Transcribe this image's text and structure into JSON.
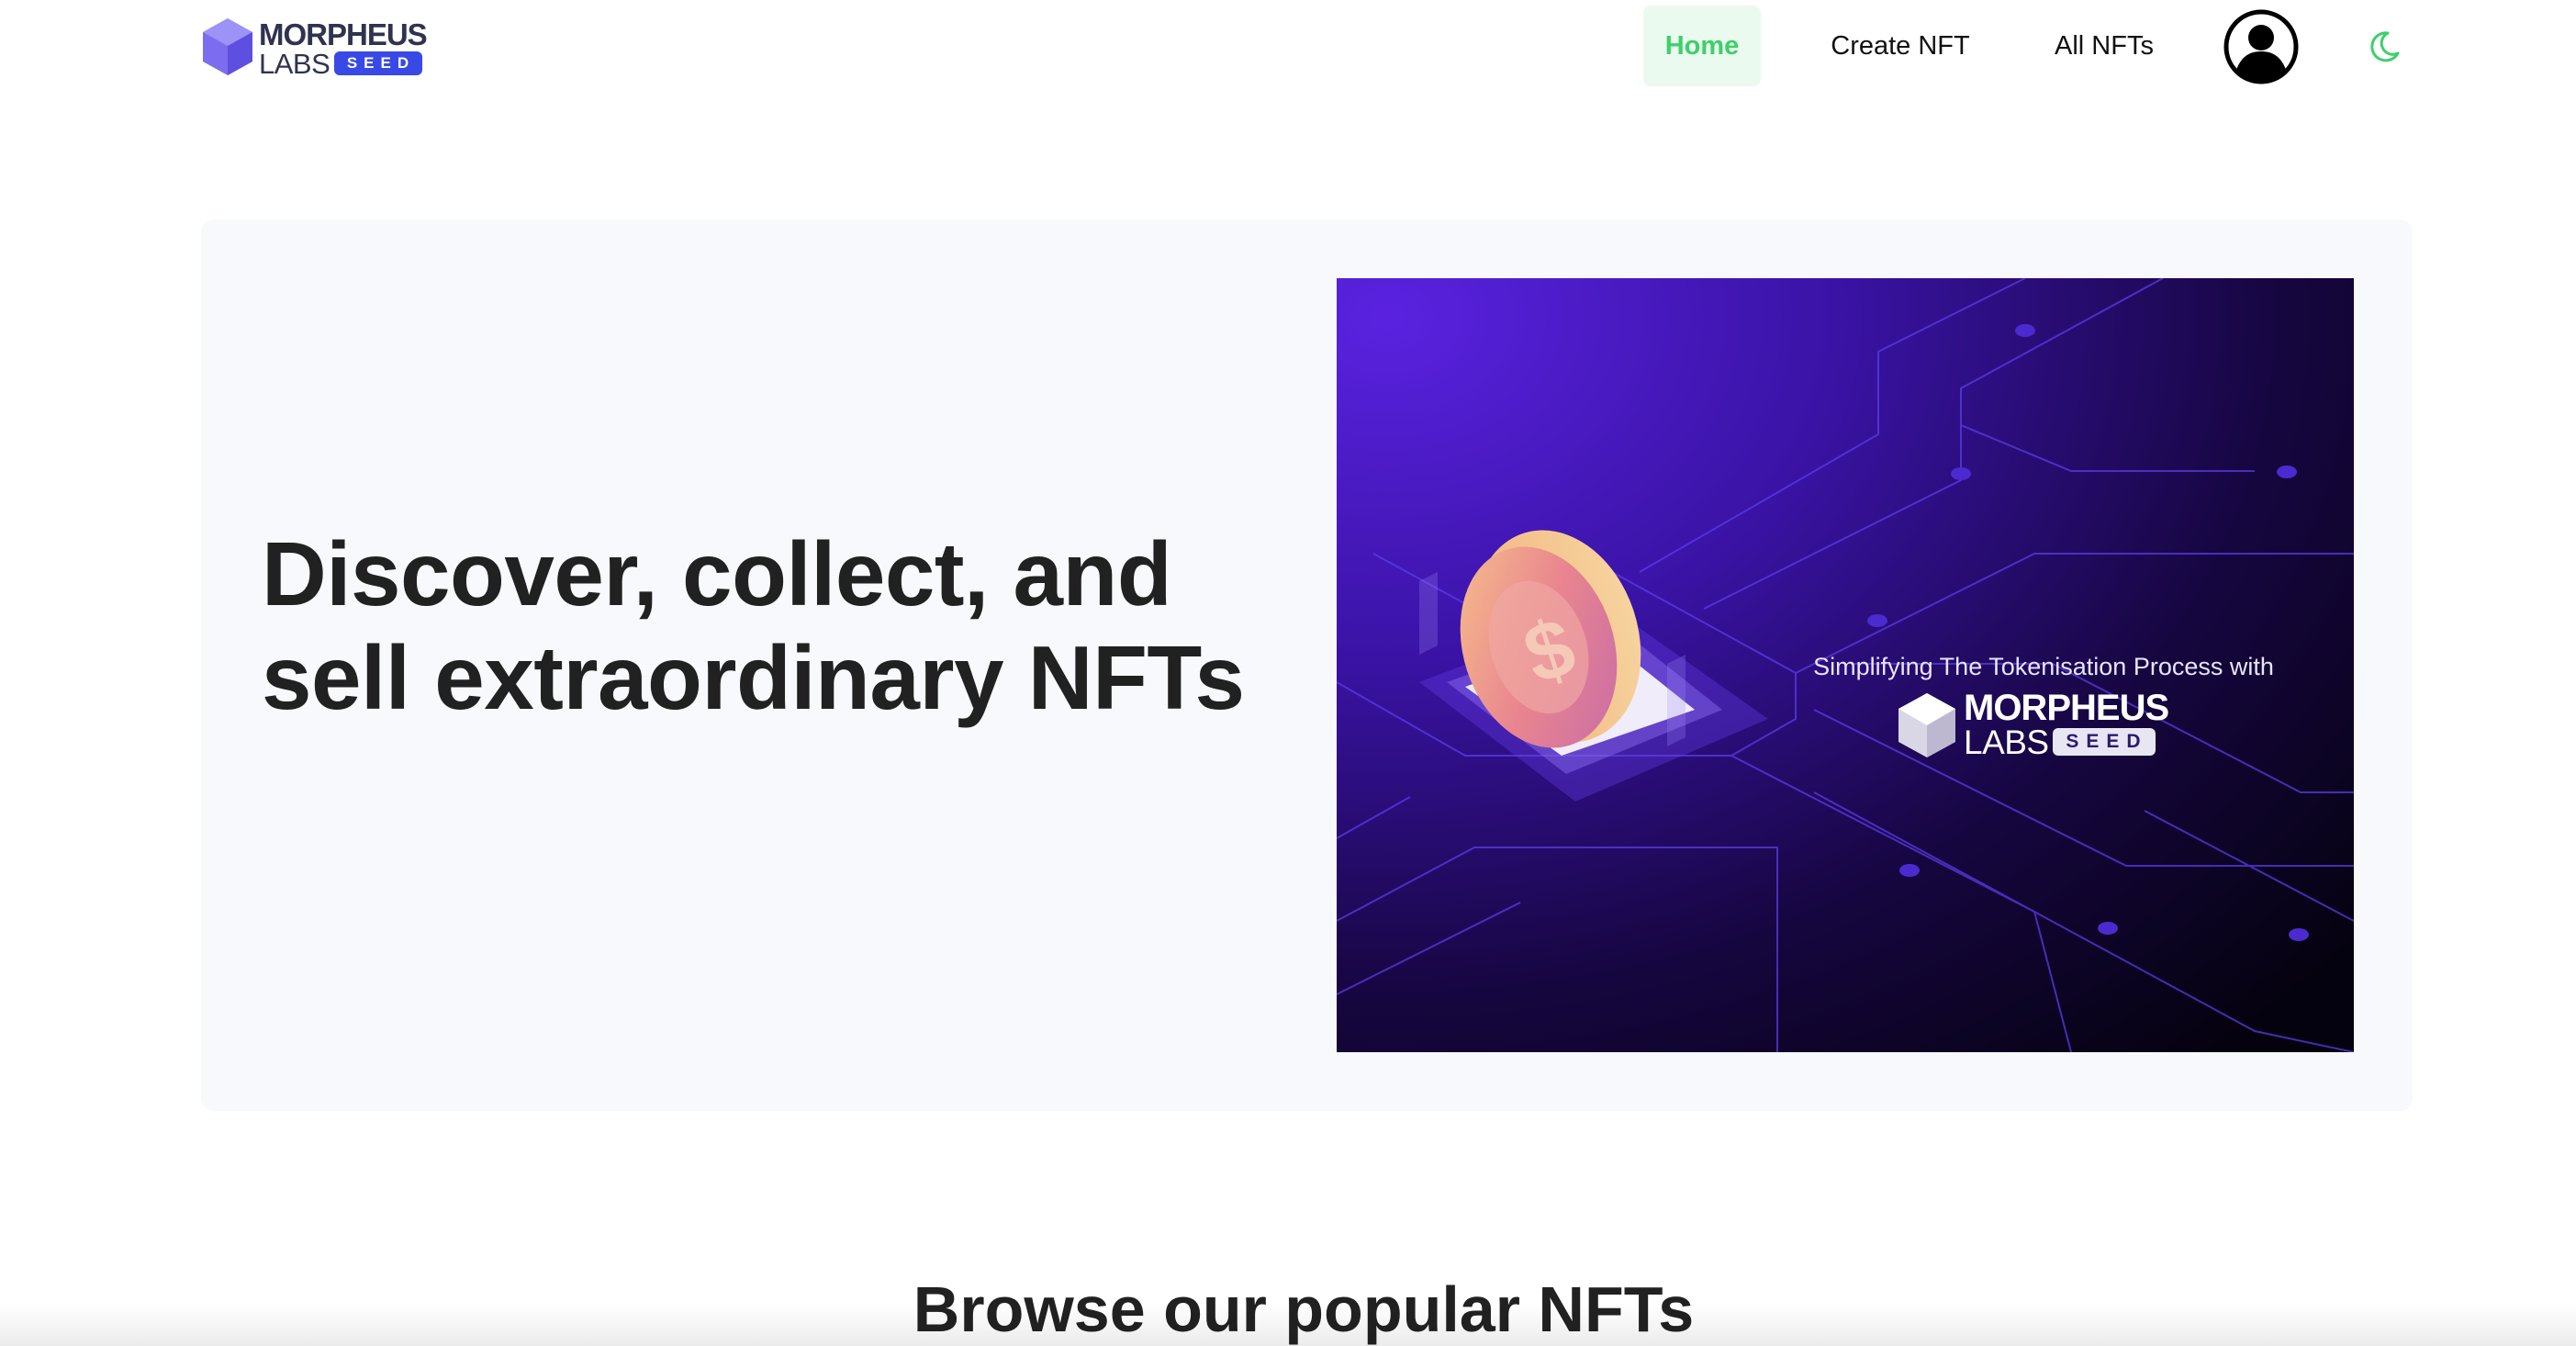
{
  "brand": {
    "name_line1": "MORPHEUS",
    "name_line2": "LABS",
    "badge": "SEED",
    "accent": "#3849e6",
    "mark_color": "#7b6cf0"
  },
  "nav": {
    "items": [
      {
        "label": "Home",
        "active": true
      },
      {
        "label": "Create NFT",
        "active": false
      },
      {
        "label": "All NFTs",
        "active": false
      }
    ],
    "active_color": "#3ecf6b",
    "active_bg": "#ebfaef",
    "profile_icon": "user-circle-icon",
    "theme_icon": "moon-icon"
  },
  "hero": {
    "title_line1": "Discover, collect, and",
    "title_line2": "sell extraordinary NFTs",
    "banner": {
      "caption": "Simplifying The Tokenisation Process with",
      "logo_line1": "MORPHEUS",
      "logo_line2": "LABS",
      "logo_badge": "SEED",
      "bg_from": "#5a22e0",
      "bg_to": "#05020f",
      "coin_icon": "dollar-coin-icon"
    }
  },
  "popular": {
    "title": "Browse our popular NFTs"
  }
}
